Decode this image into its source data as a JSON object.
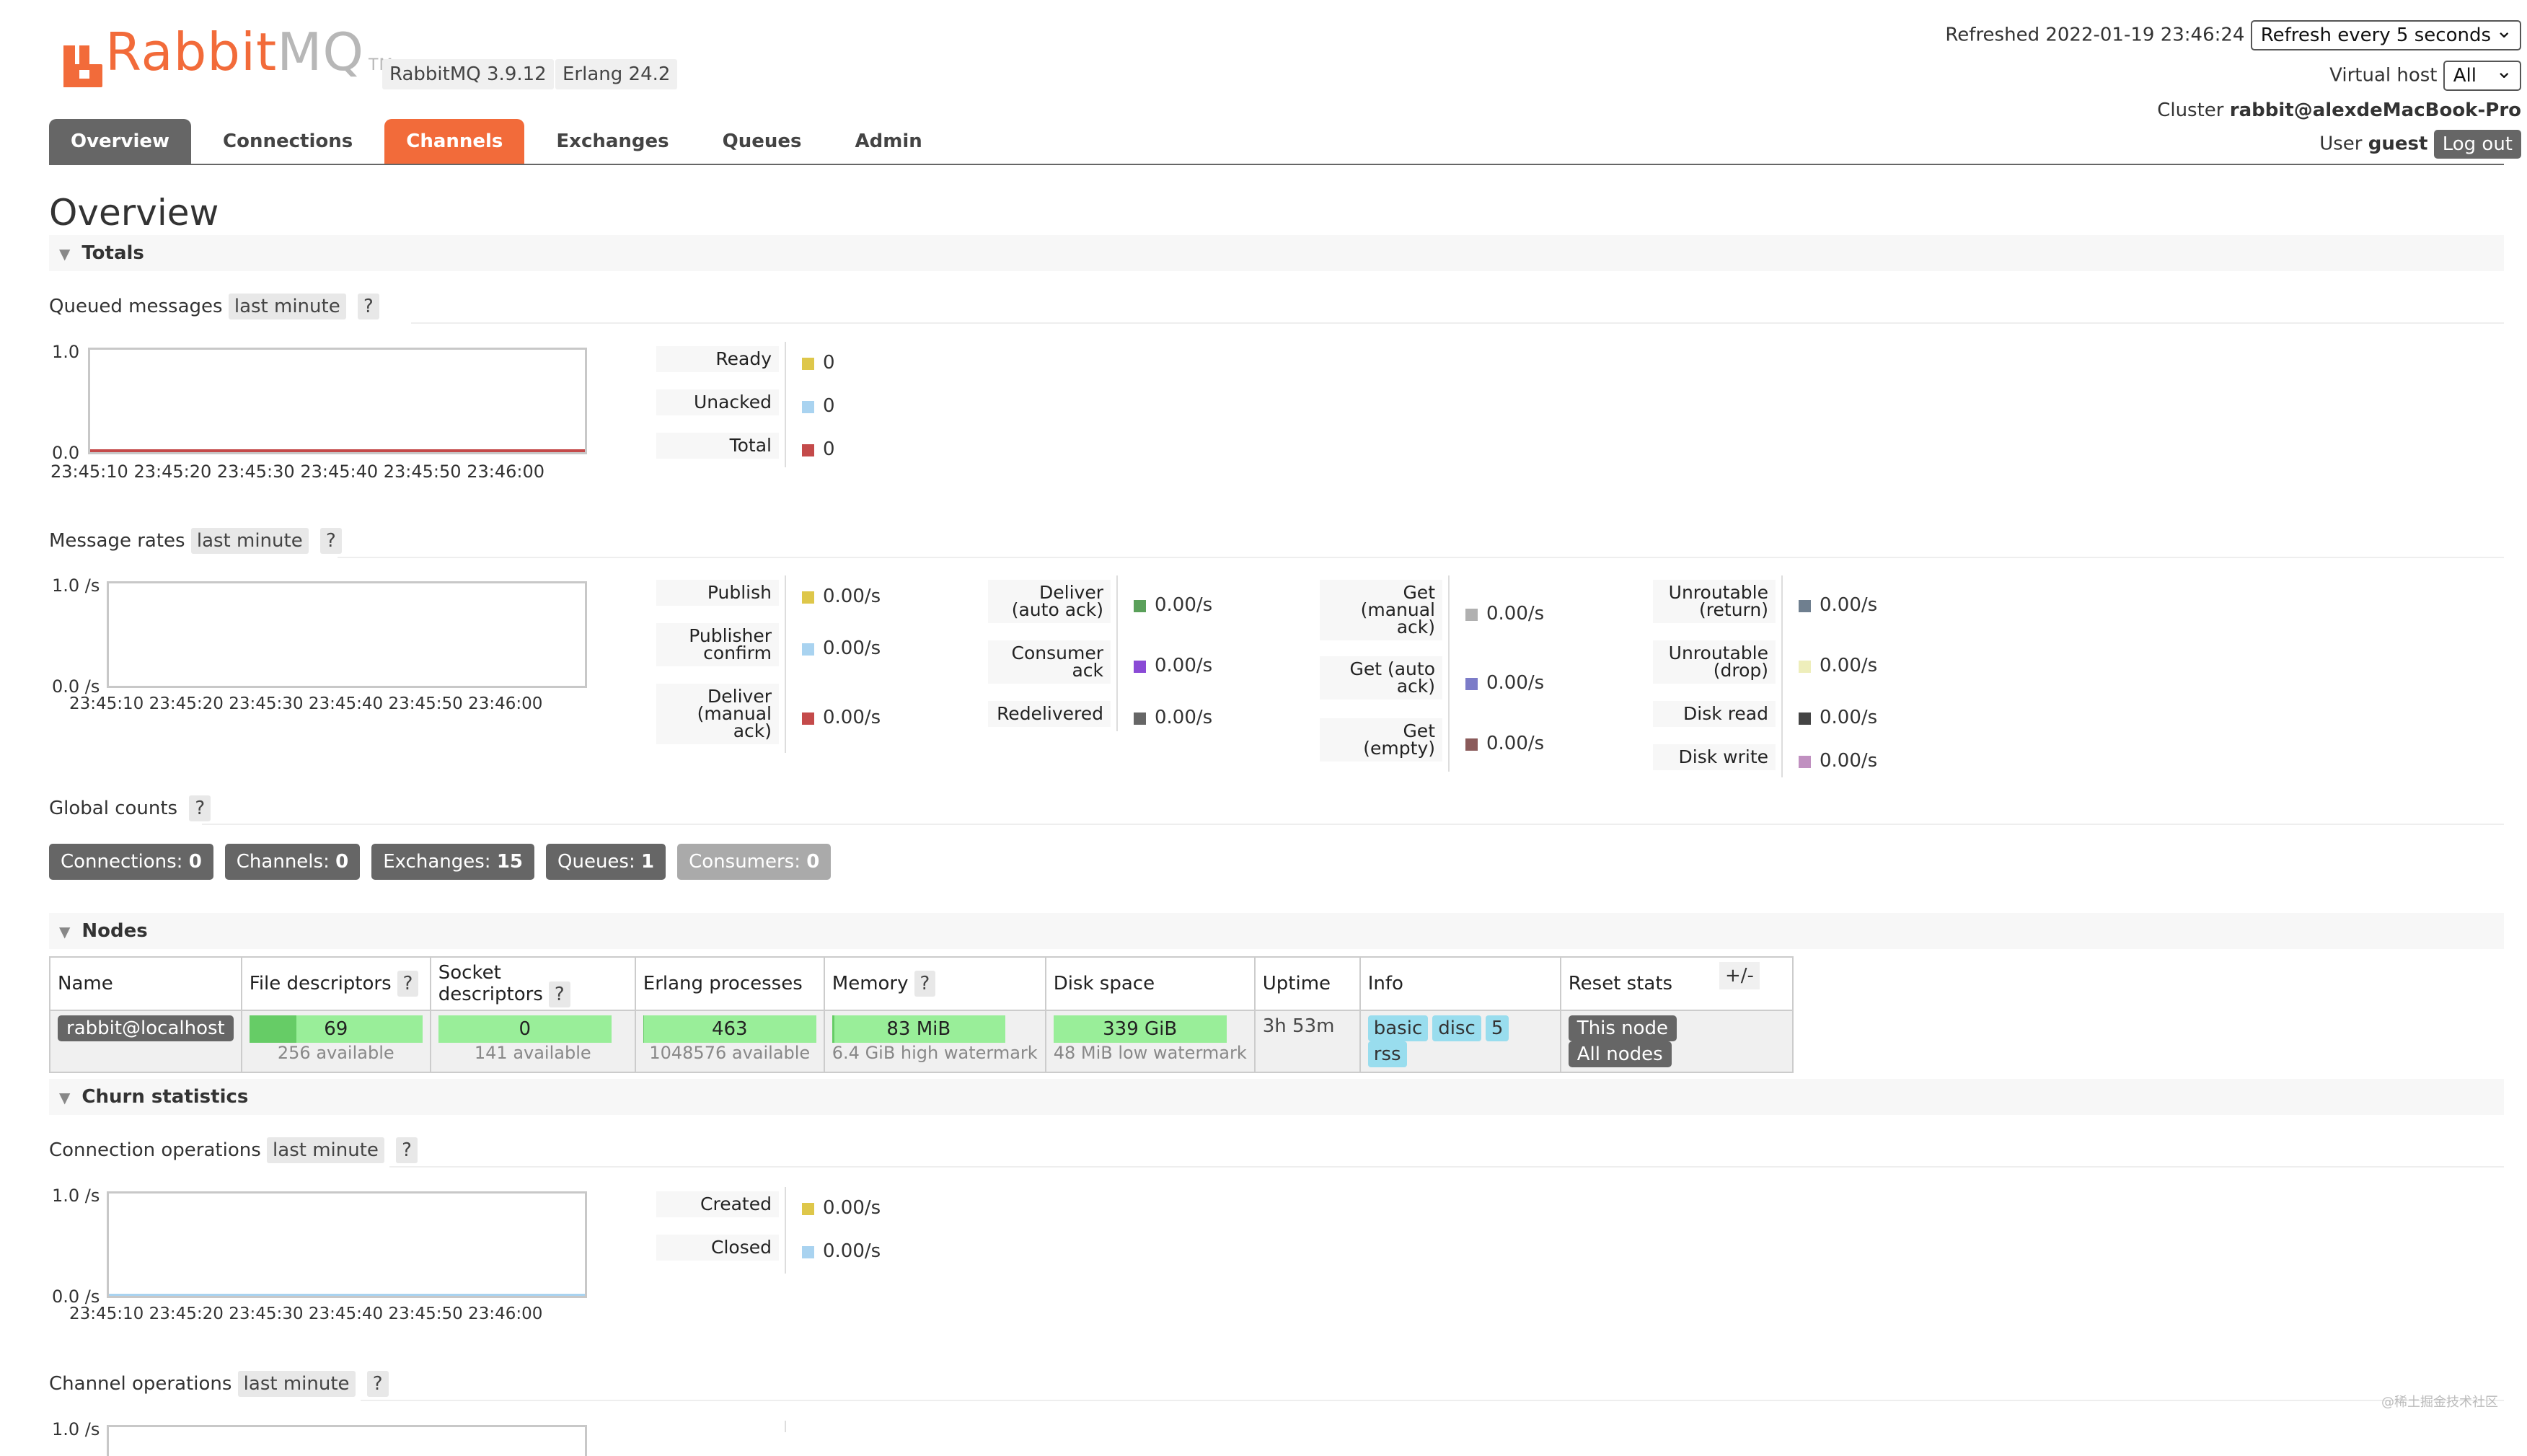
{
  "header": {
    "logo_main": "Rabbit",
    "logo_mq": "MQ",
    "logo_tm": "TM",
    "version": "RabbitMQ 3.9.12",
    "erlang": "Erlang 24.2",
    "refreshed_label": "Refreshed 2022-01-19 23:46:24",
    "refresh_select": "Refresh every 5 seconds",
    "vhost_label": "Virtual host",
    "vhost_select": "All",
    "cluster_label": "Cluster",
    "cluster_value": "rabbit@alexdeMacBook-Pro",
    "user_label": "User",
    "user_value": "guest",
    "logout": "Log out"
  },
  "tabs": [
    "Overview",
    "Connections",
    "Channels",
    "Exchanges",
    "Queues",
    "Admin"
  ],
  "page_title": "Overview",
  "totals": {
    "title": "Totals",
    "queued": {
      "label": "Queued messages",
      "range": "last minute",
      "help": "?",
      "y_top": "1.0",
      "y_bottom": "0.0",
      "x_ticks": [
        "23:45:10",
        "23:45:20",
        "23:45:30",
        "23:45:40",
        "23:45:50",
        "23:46:00"
      ],
      "legend": [
        {
          "label": "Ready",
          "value": "0",
          "color": "#dec74a"
        },
        {
          "label": "Unacked",
          "value": "0",
          "color": "#a9d3f0"
        },
        {
          "label": "Total",
          "value": "0",
          "color": "#c44a4a"
        }
      ]
    },
    "rates": {
      "label": "Message rates",
      "range": "last minute",
      "help": "?",
      "y_top": "1.0 /s",
      "y_bottom": "0.0 /s",
      "x_ticks": [
        "23:45:10",
        "23:45:20",
        "23:45:30",
        "23:45:40",
        "23:45:50",
        "23:46:00"
      ],
      "col1": [
        {
          "label": "Publish",
          "value": "0.00/s",
          "color": "#dec74a"
        },
        {
          "label": "Publisher confirm",
          "value": "0.00/s",
          "color": "#a9d3f0"
        },
        {
          "label": "Deliver (manual ack)",
          "value": "0.00/s",
          "color": "#c44a4a"
        }
      ],
      "col2": [
        {
          "label": "Deliver (auto ack)",
          "value": "0.00/s",
          "color": "#5aa05a"
        },
        {
          "label": "Consumer ack",
          "value": "0.00/s",
          "color": "#8a4ad6"
        },
        {
          "label": "Redelivered",
          "value": "0.00/s",
          "color": "#666666"
        }
      ],
      "col3": [
        {
          "label": "Get (manual ack)",
          "value": "0.00/s",
          "color": "#b0b0b0"
        },
        {
          "label": "Get (auto ack)",
          "value": "0.00/s",
          "color": "#7c7cc8"
        },
        {
          "label": "Get (empty)",
          "value": "0.00/s",
          "color": "#8a5a5a"
        }
      ],
      "col4": [
        {
          "label": "Unroutable (return)",
          "value": "0.00/s",
          "color": "#6f7f8f"
        },
        {
          "label": "Unroutable (drop)",
          "value": "0.00/s",
          "color": "#eeeebb"
        },
        {
          "label": "Disk read",
          "value": "0.00/s",
          "color": "#444444"
        },
        {
          "label": "Disk write",
          "value": "0.00/s",
          "color": "#c090c0"
        }
      ]
    }
  },
  "global_counts": {
    "label": "Global counts",
    "help": "?",
    "items": [
      {
        "label": "Connections:",
        "value": "0"
      },
      {
        "label": "Channels:",
        "value": "0"
      },
      {
        "label": "Exchanges:",
        "value": "15"
      },
      {
        "label": "Queues:",
        "value": "1"
      },
      {
        "label": "Consumers:",
        "value": "0"
      }
    ]
  },
  "nodes": {
    "title": "Nodes",
    "columns": [
      "Name",
      "File descriptors",
      "Socket descriptors",
      "Erlang processes",
      "Memory",
      "Disk space",
      "Uptime",
      "Info",
      "Reset stats"
    ],
    "help": "?",
    "plus_minus": "+/-",
    "row": {
      "name": "rabbit@localhost",
      "fd_value": "69",
      "fd_fraction": 0.27,
      "fd_sub": "256 available",
      "sock_value": "0",
      "sock_fraction": 0,
      "sock_sub": "141 available",
      "proc_value": "463",
      "proc_fraction": 0.0004,
      "proc_sub": "1048576 available",
      "mem_value": "83 MiB",
      "mem_fraction": 0.013,
      "mem_sub": "6.4 GiB high watermark",
      "disk_value": "339 GiB",
      "disk_fraction": 1,
      "disk_sub": "48 MiB low watermark",
      "uptime": "3h 53m",
      "info": [
        "basic",
        "disc",
        "5",
        "rss"
      ],
      "reset_this": "This node",
      "reset_all": "All nodes"
    }
  },
  "churn": {
    "title": "Churn statistics",
    "conn_ops": {
      "label": "Connection operations",
      "range": "last minute",
      "help": "?",
      "y_top": "1.0 /s",
      "y_bottom": "0.0 /s",
      "x_ticks": [
        "23:45:10",
        "23:45:20",
        "23:45:30",
        "23:45:40",
        "23:45:50",
        "23:46:00"
      ],
      "legend": [
        {
          "label": "Created",
          "value": "0.00/s",
          "color": "#dec74a"
        },
        {
          "label": "Closed",
          "value": "0.00/s",
          "color": "#a9d3f0"
        }
      ]
    },
    "chan_ops": {
      "label": "Channel operations",
      "range": "last minute",
      "help": "?",
      "y_top": "1.0 /s"
    }
  },
  "watermark": "@稀土掘金技术社区"
}
